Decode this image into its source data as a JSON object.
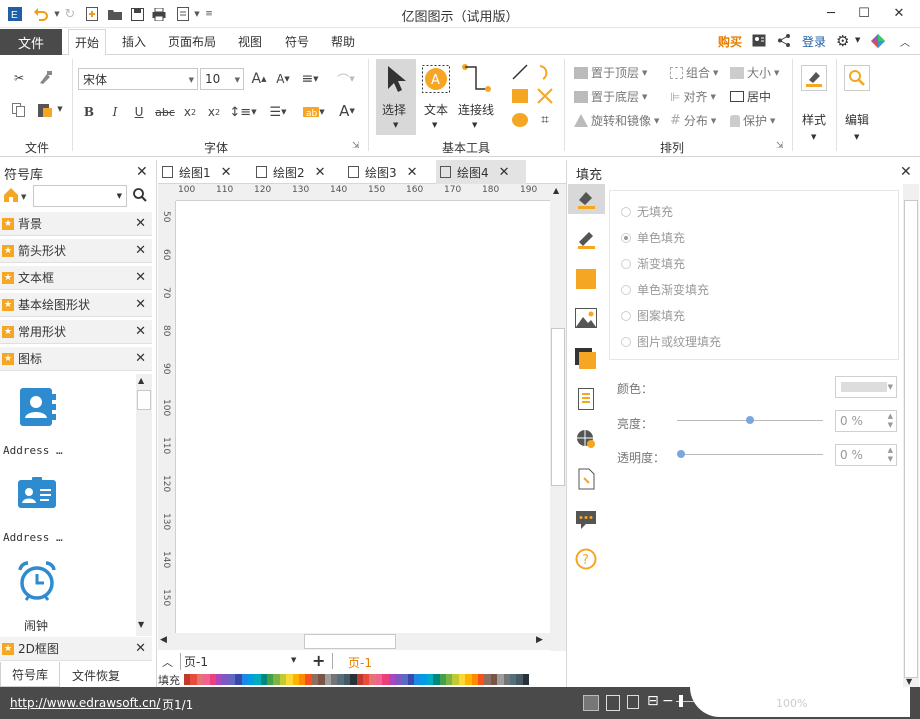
{
  "app": {
    "title": "亿图图示（试用版）"
  },
  "menu": {
    "file": "文件",
    "tabs": [
      "开始",
      "插入",
      "页面布局",
      "视图",
      "符号",
      "帮助"
    ],
    "buy": "购买",
    "login": "登录"
  },
  "ribbon": {
    "file_group": {
      "label": "文件"
    },
    "font": {
      "family": "宋体",
      "size": "10",
      "label": "字体"
    },
    "tools": {
      "select": "选择",
      "text": "文本",
      "connector": "连接线",
      "label": "基本工具"
    },
    "arrange": {
      "bring_front": "置于顶层",
      "send_back": "置于底层",
      "rotate_mirror": "旋转和镜像",
      "group": "组合",
      "align": "对齐",
      "distribute": "分布",
      "size": "大小",
      "center": "居中",
      "protect": "保护",
      "label": "排列"
    },
    "style": "样式",
    "edit": "编辑"
  },
  "library": {
    "title": "符号库",
    "categories": [
      "背景",
      "箭头形状",
      "文本框",
      "基本绘图形状",
      "常用形状",
      "图标"
    ],
    "shapes": [
      "Address …",
      "Address …",
      "闹钟"
    ],
    "bottom_category": "2D框图",
    "bottom_tabs": [
      "符号库",
      "文件恢复"
    ]
  },
  "documents": {
    "tabs": [
      "绘图1",
      "绘图2",
      "绘图3",
      "绘图4"
    ],
    "active_tab": "绘图4"
  },
  "ruler": {
    "h": [
      "100",
      "110",
      "120",
      "130",
      "140",
      "150",
      "160",
      "170",
      "180",
      "190"
    ],
    "v": [
      "50",
      "60",
      "70",
      "80",
      "90",
      "100",
      "110",
      "120",
      "130",
      "140",
      "150"
    ]
  },
  "pages": {
    "current": "页-1",
    "tab": "页-1",
    "fill_label": "填充"
  },
  "fill_panel": {
    "title": "填充",
    "options": [
      "无填充",
      "单色填充",
      "渐变填充",
      "单色渐变填充",
      "图案填充",
      "图片或纹理填充"
    ],
    "selected": "单色填充",
    "color_label": "颜色：",
    "brightness_label": "亮度：",
    "brightness_value": "0 %",
    "brightness_level": 0.5,
    "transparency_label": "透明度：",
    "transparency_value": "0 %",
    "transparency_level": 0
  },
  "status": {
    "url": "http://www.edrawsoft.cn/",
    "page": "页1/1",
    "zoom": "100%"
  },
  "colors": {
    "accent": "#f5a623",
    "dark": "#4a4a4a",
    "blue_icon": "#2e8bd0"
  }
}
